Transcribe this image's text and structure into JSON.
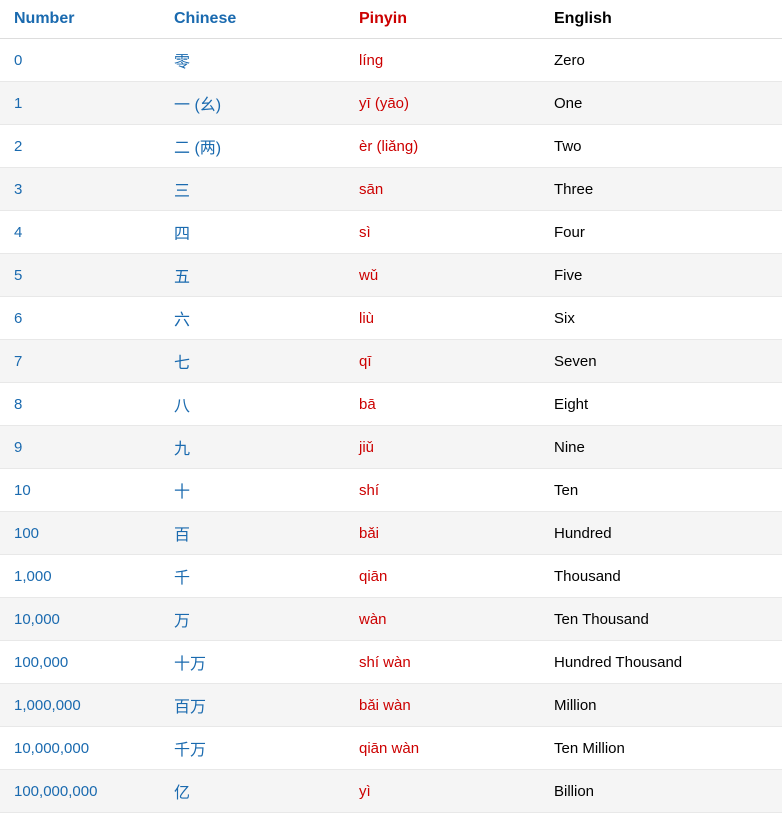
{
  "table": {
    "headers": {
      "number": "Number",
      "chinese": "Chinese",
      "pinyin": "Pinyin",
      "english": "English"
    },
    "rows": [
      {
        "number": "0",
        "chinese": "零",
        "pinyin": "líng",
        "english": "Zero"
      },
      {
        "number": "1",
        "chinese": "一 (幺)",
        "pinyin": "yī  (yāo)",
        "english": "One"
      },
      {
        "number": "2",
        "chinese": "二 (两)",
        "pinyin": "èr (liǎng)",
        "english": "Two"
      },
      {
        "number": "3",
        "chinese": "三",
        "pinyin": "sān",
        "english": "Three"
      },
      {
        "number": "4",
        "chinese": "四",
        "pinyin": "sì",
        "english": "Four"
      },
      {
        "number": "5",
        "chinese": "五",
        "pinyin": "wǔ",
        "english": "Five"
      },
      {
        "number": "6",
        "chinese": "六",
        "pinyin": "liù",
        "english": "Six"
      },
      {
        "number": "7",
        "chinese": "七",
        "pinyin": "qī",
        "english": "Seven"
      },
      {
        "number": "8",
        "chinese": "八",
        "pinyin": "bā",
        "english": "Eight"
      },
      {
        "number": "9",
        "chinese": "九",
        "pinyin": "jiǔ",
        "english": "Nine"
      },
      {
        "number": "10",
        "chinese": "十",
        "pinyin": "shí",
        "english": "Ten"
      },
      {
        "number": "100",
        "chinese": "百",
        "pinyin": "bǎi",
        "english": "Hundred"
      },
      {
        "number": "1,000",
        "chinese": "千",
        "pinyin": "qiān",
        "english": "Thousand"
      },
      {
        "number": "10,000",
        "chinese": "万",
        "pinyin": "wàn",
        "english": "Ten Thousand"
      },
      {
        "number": "100,000",
        "chinese": "十万",
        "pinyin": "shí wàn",
        "english": "Hundred Thousand"
      },
      {
        "number": "1,000,000",
        "chinese": "百万",
        "pinyin": "bǎi wàn",
        "english": "Million"
      },
      {
        "number": "10,000,000",
        "chinese": "千万",
        "pinyin": "qiān  wàn",
        "english": "Ten Million"
      },
      {
        "number": "100,000,000",
        "chinese": "亿",
        "pinyin": "yì",
        "english": "Billion"
      }
    ]
  }
}
